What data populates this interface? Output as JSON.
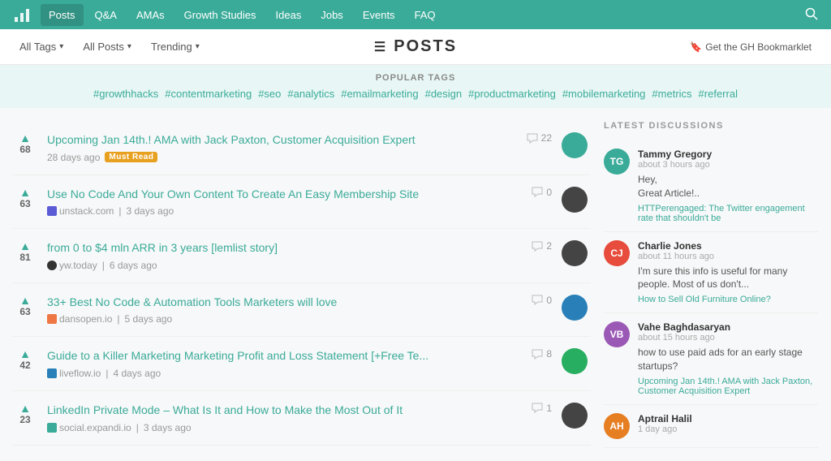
{
  "navbar": {
    "links": [
      {
        "label": "Posts",
        "active": true
      },
      {
        "label": "Q&A",
        "active": false
      },
      {
        "label": "AMAs",
        "active": false
      },
      {
        "label": "Growth Studies",
        "active": false
      },
      {
        "label": "Ideas",
        "active": false
      },
      {
        "label": "Jobs",
        "active": false
      },
      {
        "label": "Events",
        "active": false
      },
      {
        "label": "FAQ",
        "active": false
      }
    ]
  },
  "toolbar": {
    "all_tags_label": "All Tags",
    "all_posts_label": "All Posts",
    "trending_label": "Trending",
    "page_title": "POSTS",
    "bookmarklet_label": "Get the GH Bookmarklet"
  },
  "popular_tags": {
    "label": "POPULAR TAGS",
    "tags": [
      "#growthhacks",
      "#contentmarketing",
      "#seo",
      "#analytics",
      "#emailmarketing",
      "#design",
      "#productmarketing",
      "#mobilemarketing",
      "#metrics",
      "#referral"
    ]
  },
  "posts": [
    {
      "votes": "68",
      "title": "Upcoming Jan 14th.! AMA with Jack Paxton, Customer Acquisition Expert",
      "age": "28 days ago",
      "badge": "Must Read",
      "source": "",
      "source_label": "",
      "comments": "22",
      "avatar_class": "teal"
    },
    {
      "votes": "63",
      "title": "Use No Code And Your Own Content To Create An Easy Membership Site",
      "age": "3 days ago",
      "badge": "",
      "source": "unstack",
      "source_label": "unstack.com",
      "comments": "0",
      "avatar_class": "dark"
    },
    {
      "votes": "81",
      "title": "from 0 to $4 mln ARR in 3 years [lemlist story]",
      "age": "6 days ago",
      "badge": "",
      "source": "lemio",
      "source_label": "yw.today",
      "comments": "2",
      "avatar_class": "dark"
    },
    {
      "votes": "63",
      "title": "33+ Best No Code & Automation Tools Marketers will love",
      "age": "5 days ago",
      "badge": "",
      "source": "dansopen",
      "source_label": "dansopen.io",
      "comments": "0",
      "avatar_class": "blue"
    },
    {
      "votes": "42",
      "title": "Guide to a Killer Marketing Marketing Profit and Loss Statement [+Free Te...",
      "age": "4 days ago",
      "badge": "",
      "source": "liveflow",
      "source_label": "liveflow.io",
      "comments": "8",
      "avatar_class": "green"
    },
    {
      "votes": "23",
      "title": "LinkedIn Private Mode – What Is It and How to Make the Most Out of It",
      "age": "3 days ago",
      "badge": "",
      "source": "expand",
      "source_label": "social.expandi.io",
      "comments": "1",
      "avatar_class": "dark"
    }
  ],
  "sidebar": {
    "title": "LATEST DISCUSSIONS",
    "discussions": [
      {
        "initials": "TG",
        "avatar_class": "tg",
        "name": "Tammy Gregory",
        "time": "about 3 hours ago",
        "text": "Hey,\nGreat Article!..",
        "link": "HTTPerengaged: The Twitter engagement rate that shouldn't be"
      },
      {
        "initials": "CJ",
        "avatar_class": "cj",
        "name": "Charlie Jones",
        "time": "about 11 hours ago",
        "text": "I'm sure this info is useful for many people. Most of us don't...",
        "link": "How to Sell Old Furniture Online?"
      },
      {
        "initials": "VB",
        "avatar_class": "vb",
        "name": "Vahe Baghdasaryan",
        "time": "about 15 hours ago",
        "text": "how to use paid ads for an early stage startups?",
        "link": "Upcoming Jan 14th.! AMA with Jack Paxton, Customer Acquisition Expert"
      },
      {
        "initials": "AH",
        "avatar_class": "ah",
        "name": "Aptrail Halil",
        "time": "1 day ago",
        "text": "",
        "link": ""
      }
    ]
  }
}
